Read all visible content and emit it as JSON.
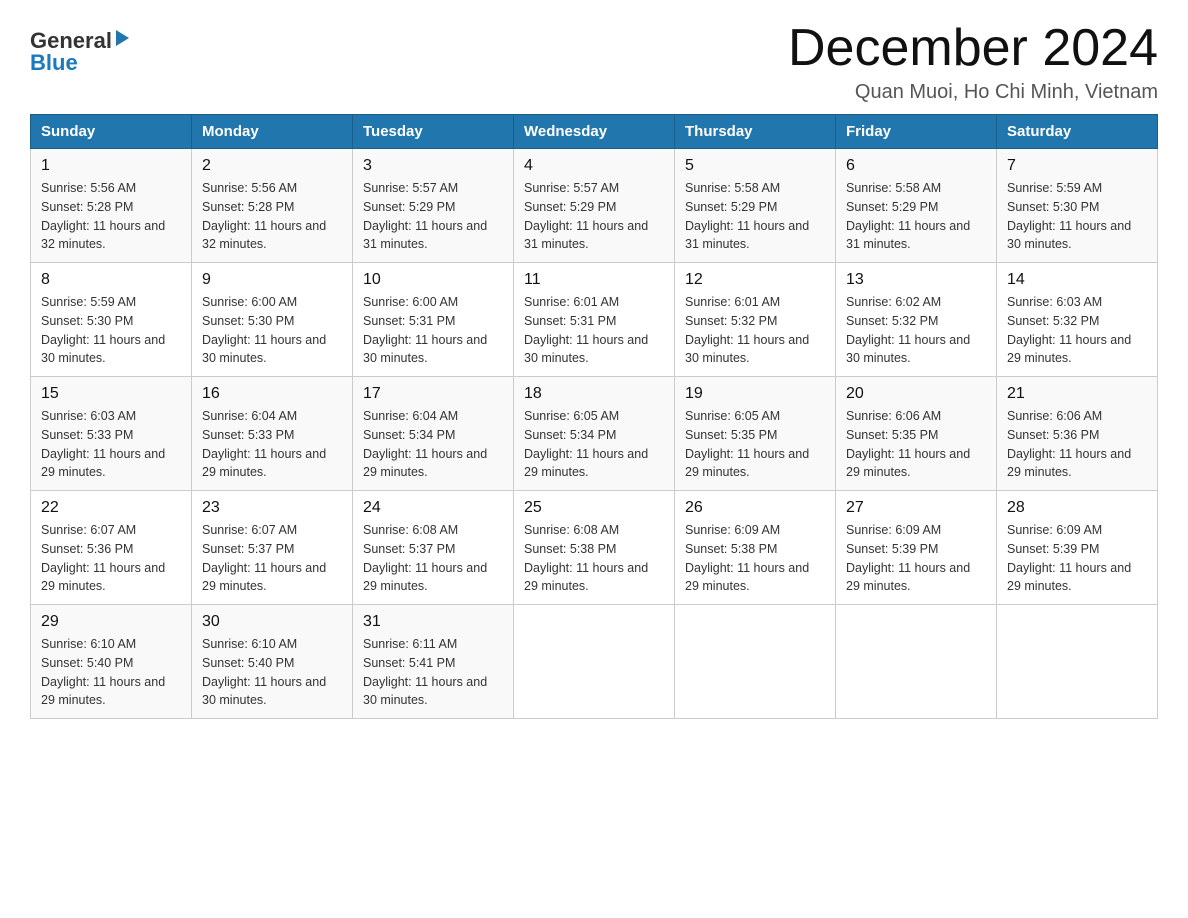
{
  "header": {
    "title": "December 2024",
    "location": "Quan Muoi, Ho Chi Minh, Vietnam",
    "logo_general": "General",
    "logo_blue": "Blue"
  },
  "weekdays": [
    "Sunday",
    "Monday",
    "Tuesday",
    "Wednesday",
    "Thursday",
    "Friday",
    "Saturday"
  ],
  "weeks": [
    [
      {
        "day": "1",
        "sunrise": "5:56 AM",
        "sunset": "5:28 PM",
        "daylight": "11 hours and 32 minutes."
      },
      {
        "day": "2",
        "sunrise": "5:56 AM",
        "sunset": "5:28 PM",
        "daylight": "11 hours and 32 minutes."
      },
      {
        "day": "3",
        "sunrise": "5:57 AM",
        "sunset": "5:29 PM",
        "daylight": "11 hours and 31 minutes."
      },
      {
        "day": "4",
        "sunrise": "5:57 AM",
        "sunset": "5:29 PM",
        "daylight": "11 hours and 31 minutes."
      },
      {
        "day": "5",
        "sunrise": "5:58 AM",
        "sunset": "5:29 PM",
        "daylight": "11 hours and 31 minutes."
      },
      {
        "day": "6",
        "sunrise": "5:58 AM",
        "sunset": "5:29 PM",
        "daylight": "11 hours and 31 minutes."
      },
      {
        "day": "7",
        "sunrise": "5:59 AM",
        "sunset": "5:30 PM",
        "daylight": "11 hours and 30 minutes."
      }
    ],
    [
      {
        "day": "8",
        "sunrise": "5:59 AM",
        "sunset": "5:30 PM",
        "daylight": "11 hours and 30 minutes."
      },
      {
        "day": "9",
        "sunrise": "6:00 AM",
        "sunset": "5:30 PM",
        "daylight": "11 hours and 30 minutes."
      },
      {
        "day": "10",
        "sunrise": "6:00 AM",
        "sunset": "5:31 PM",
        "daylight": "11 hours and 30 minutes."
      },
      {
        "day": "11",
        "sunrise": "6:01 AM",
        "sunset": "5:31 PM",
        "daylight": "11 hours and 30 minutes."
      },
      {
        "day": "12",
        "sunrise": "6:01 AM",
        "sunset": "5:32 PM",
        "daylight": "11 hours and 30 minutes."
      },
      {
        "day": "13",
        "sunrise": "6:02 AM",
        "sunset": "5:32 PM",
        "daylight": "11 hours and 30 minutes."
      },
      {
        "day": "14",
        "sunrise": "6:03 AM",
        "sunset": "5:32 PM",
        "daylight": "11 hours and 29 minutes."
      }
    ],
    [
      {
        "day": "15",
        "sunrise": "6:03 AM",
        "sunset": "5:33 PM",
        "daylight": "11 hours and 29 minutes."
      },
      {
        "day": "16",
        "sunrise": "6:04 AM",
        "sunset": "5:33 PM",
        "daylight": "11 hours and 29 minutes."
      },
      {
        "day": "17",
        "sunrise": "6:04 AM",
        "sunset": "5:34 PM",
        "daylight": "11 hours and 29 minutes."
      },
      {
        "day": "18",
        "sunrise": "6:05 AM",
        "sunset": "5:34 PM",
        "daylight": "11 hours and 29 minutes."
      },
      {
        "day": "19",
        "sunrise": "6:05 AM",
        "sunset": "5:35 PM",
        "daylight": "11 hours and 29 minutes."
      },
      {
        "day": "20",
        "sunrise": "6:06 AM",
        "sunset": "5:35 PM",
        "daylight": "11 hours and 29 minutes."
      },
      {
        "day": "21",
        "sunrise": "6:06 AM",
        "sunset": "5:36 PM",
        "daylight": "11 hours and 29 minutes."
      }
    ],
    [
      {
        "day": "22",
        "sunrise": "6:07 AM",
        "sunset": "5:36 PM",
        "daylight": "11 hours and 29 minutes."
      },
      {
        "day": "23",
        "sunrise": "6:07 AM",
        "sunset": "5:37 PM",
        "daylight": "11 hours and 29 minutes."
      },
      {
        "day": "24",
        "sunrise": "6:08 AM",
        "sunset": "5:37 PM",
        "daylight": "11 hours and 29 minutes."
      },
      {
        "day": "25",
        "sunrise": "6:08 AM",
        "sunset": "5:38 PM",
        "daylight": "11 hours and 29 minutes."
      },
      {
        "day": "26",
        "sunrise": "6:09 AM",
        "sunset": "5:38 PM",
        "daylight": "11 hours and 29 minutes."
      },
      {
        "day": "27",
        "sunrise": "6:09 AM",
        "sunset": "5:39 PM",
        "daylight": "11 hours and 29 minutes."
      },
      {
        "day": "28",
        "sunrise": "6:09 AM",
        "sunset": "5:39 PM",
        "daylight": "11 hours and 29 minutes."
      }
    ],
    [
      {
        "day": "29",
        "sunrise": "6:10 AM",
        "sunset": "5:40 PM",
        "daylight": "11 hours and 29 minutes."
      },
      {
        "day": "30",
        "sunrise": "6:10 AM",
        "sunset": "5:40 PM",
        "daylight": "11 hours and 30 minutes."
      },
      {
        "day": "31",
        "sunrise": "6:11 AM",
        "sunset": "5:41 PM",
        "daylight": "11 hours and 30 minutes."
      },
      null,
      null,
      null,
      null
    ]
  ]
}
